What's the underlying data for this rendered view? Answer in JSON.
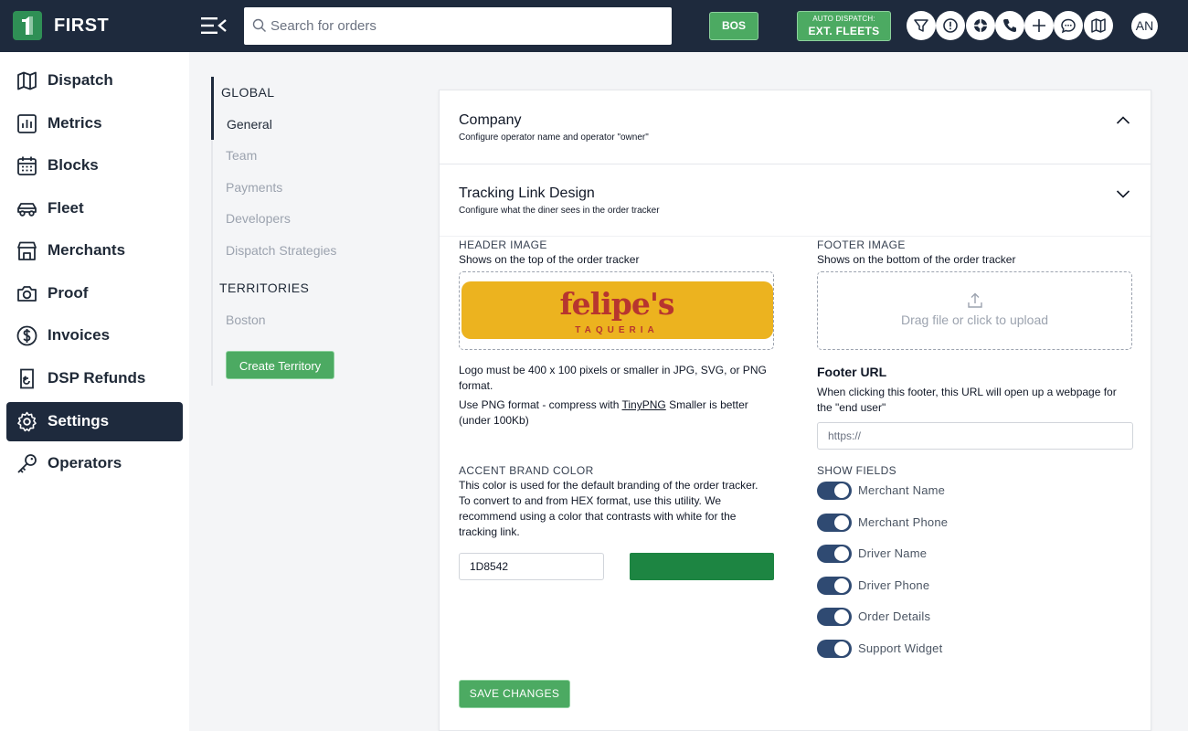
{
  "app": {
    "brand": "FIRST",
    "search_placeholder": "Search for orders",
    "market_button": "BOS",
    "auto_dispatch": {
      "caption": "AUTO DISPATCH:",
      "value": "EXT. FLEETS"
    },
    "toolbar_icons": [
      "filter-icon",
      "alert-icon",
      "support-icon",
      "phone-icon",
      "plus-icon",
      "chat-icon",
      "map-icon"
    ],
    "user_initials": "AN"
  },
  "sidebar": {
    "items": [
      {
        "label": "Dispatch",
        "icon": "map-icon"
      },
      {
        "label": "Metrics",
        "icon": "chart-icon"
      },
      {
        "label": "Blocks",
        "icon": "calendar-icon"
      },
      {
        "label": "Fleet",
        "icon": "car-icon"
      },
      {
        "label": "Merchants",
        "icon": "store-icon"
      },
      {
        "label": "Proof",
        "icon": "camera-icon"
      },
      {
        "label": "Invoices",
        "icon": "dollar-icon"
      },
      {
        "label": "DSP Refunds",
        "icon": "refund-icon"
      },
      {
        "label": "Settings",
        "icon": "gear-icon",
        "active": true
      },
      {
        "label": "Operators",
        "icon": "key-icon"
      }
    ]
  },
  "settings_nav": {
    "global_heading": "GLOBAL",
    "global_items": [
      "General",
      "Team",
      "Payments",
      "Developers",
      "Dispatch Strategies"
    ],
    "territories_heading": "TERRITORIES",
    "territory_items": [
      "Boston"
    ],
    "create_button": "Create Territory"
  },
  "company": {
    "title": "Company",
    "subtitle": "Configure operator name and operator \"owner\""
  },
  "tracking": {
    "title": "Tracking Link Design",
    "subtitle": "Configure what the diner sees in the order tracker",
    "header_image": {
      "label": "HEADER IMAGE",
      "desc": "Shows on the top of the order tracker",
      "logo_word": "felipe's",
      "logo_sub": "TAQUERIA"
    },
    "logo_note": "Logo must be 400 x 100 pixels or smaller in JPG, SVG, or PNG format.",
    "png_note_prefix": "Use PNG format - compress with ",
    "png_note_link": "TinyPNG",
    "png_note_suffix": " Smaller is better (under 100Kb)",
    "footer_image": {
      "label": "FOOTER IMAGE",
      "desc": "Shows on the bottom of the order tracker",
      "upload_text": "Drag file or click to upload"
    },
    "footer_url": {
      "heading": "Footer URL",
      "desc": "When clicking this footer, this URL will open up a webpage for the \"end user\"",
      "placeholder": "https://"
    },
    "accent": {
      "label": "ACCENT BRAND COLOR",
      "desc": "This color is used for the default branding of the order tracker. To convert to and from HEX format, use this utility. We recommend using a color that contrasts with white for the tracking link.",
      "value": "1D8542",
      "swatch": "#1D8542"
    },
    "show_fields": {
      "label": "SHOW FIELDS",
      "items": [
        {
          "label": "Merchant Name",
          "on": true
        },
        {
          "label": "Merchant Phone",
          "on": true
        },
        {
          "label": "Driver Name",
          "on": true
        },
        {
          "label": "Driver Phone",
          "on": true
        },
        {
          "label": "Order Details",
          "on": true
        },
        {
          "label": "Support Widget",
          "on": true
        }
      ]
    },
    "save_button": "SAVE CHANGES"
  },
  "colors": {
    "topbar": "#1e2a3d",
    "accent_green": "#4caa62",
    "toggle_on": "#2f4a72"
  }
}
